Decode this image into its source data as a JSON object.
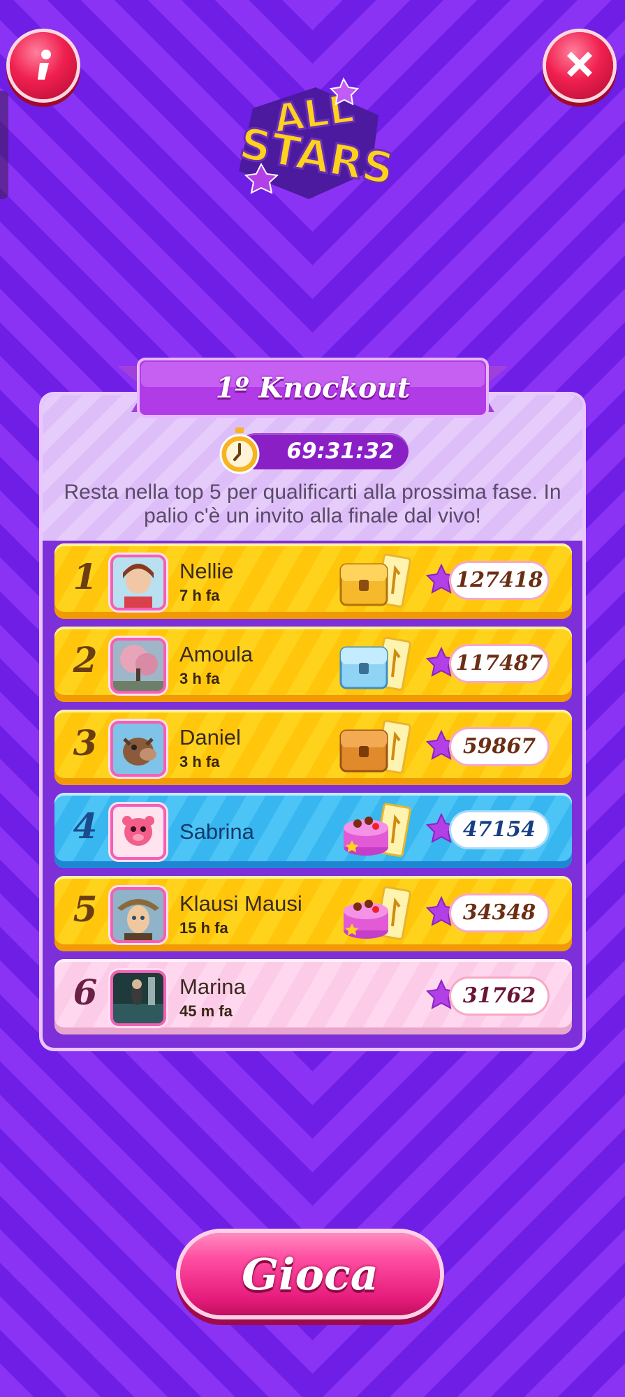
{
  "header": {
    "logo_text_1": "ALL",
    "logo_text_2": "STARS",
    "info_icon": "info-icon",
    "close_icon": "close-icon"
  },
  "event": {
    "title": "1º Knockout",
    "timer": "69:31:32",
    "description": "Resta nella top 5 per qualificarti alla prossima fase. In palio c'è un invito alla finale dal vivo!"
  },
  "leaderboard": [
    {
      "rank": "1",
      "name": "Nellie",
      "time": "7 h fa",
      "score": "127418",
      "prize": "gold-chest-icon",
      "style": "gold"
    },
    {
      "rank": "2",
      "name": "Amoula",
      "time": "3 h fa",
      "score": "117487",
      "prize": "silver-chest-icon",
      "style": "gold"
    },
    {
      "rank": "3",
      "name": "Daniel",
      "time": "3 h fa",
      "score": "59867",
      "prize": "bronze-chest-icon",
      "style": "gold"
    },
    {
      "rank": "4",
      "name": "Sabrina",
      "time": "",
      "score": "47154",
      "prize": "cake-icon",
      "style": "blue"
    },
    {
      "rank": "5",
      "name": "Klausi Mausi",
      "time": "15 h fa",
      "score": "34348",
      "prize": "cake-icon",
      "style": "gold"
    },
    {
      "rank": "6",
      "name": "Marina",
      "time": "45 m fa",
      "score": "31762",
      "prize": "",
      "style": "pink"
    }
  ],
  "play_button": {
    "label": "Gioca"
  },
  "colors": {
    "background": "#7a22ee",
    "row_gold": "#ffd21c",
    "row_blue": "#4cc4f6",
    "row_pink": "#ffd7ef",
    "button": "#ff4fa3"
  }
}
